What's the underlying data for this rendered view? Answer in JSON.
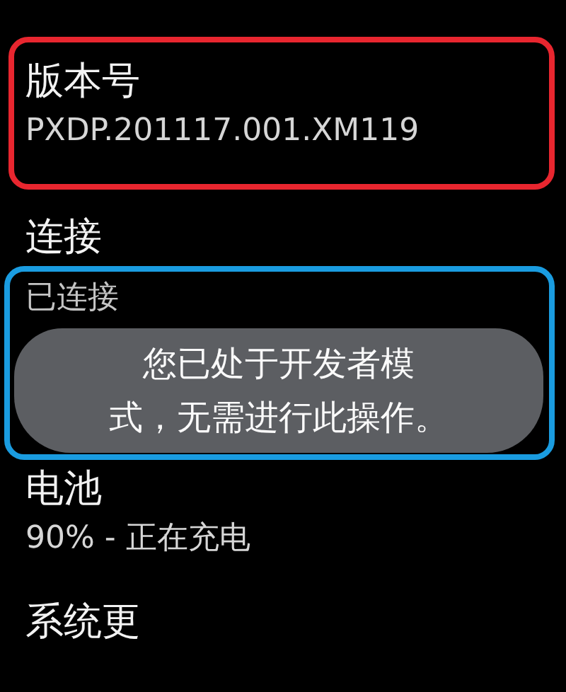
{
  "settings": [
    {
      "title": "版本号",
      "summary": "PXDP.201117.001.XM119",
      "frame": {
        "kind": "item",
        "color": "#e8262f"
      }
    },
    {
      "title": "连接",
      "summary": "已连接",
      "frame": {
        "kind": "summary",
        "color": "#1a9ce0"
      }
    },
    {
      "title": "电池",
      "summary": "90% - 正在充电"
    },
    {
      "title": "系统更"
    }
  ],
  "toast": {
    "lines": [
      "您已处于开发者模",
      "式，无需进行此操作。"
    ]
  }
}
